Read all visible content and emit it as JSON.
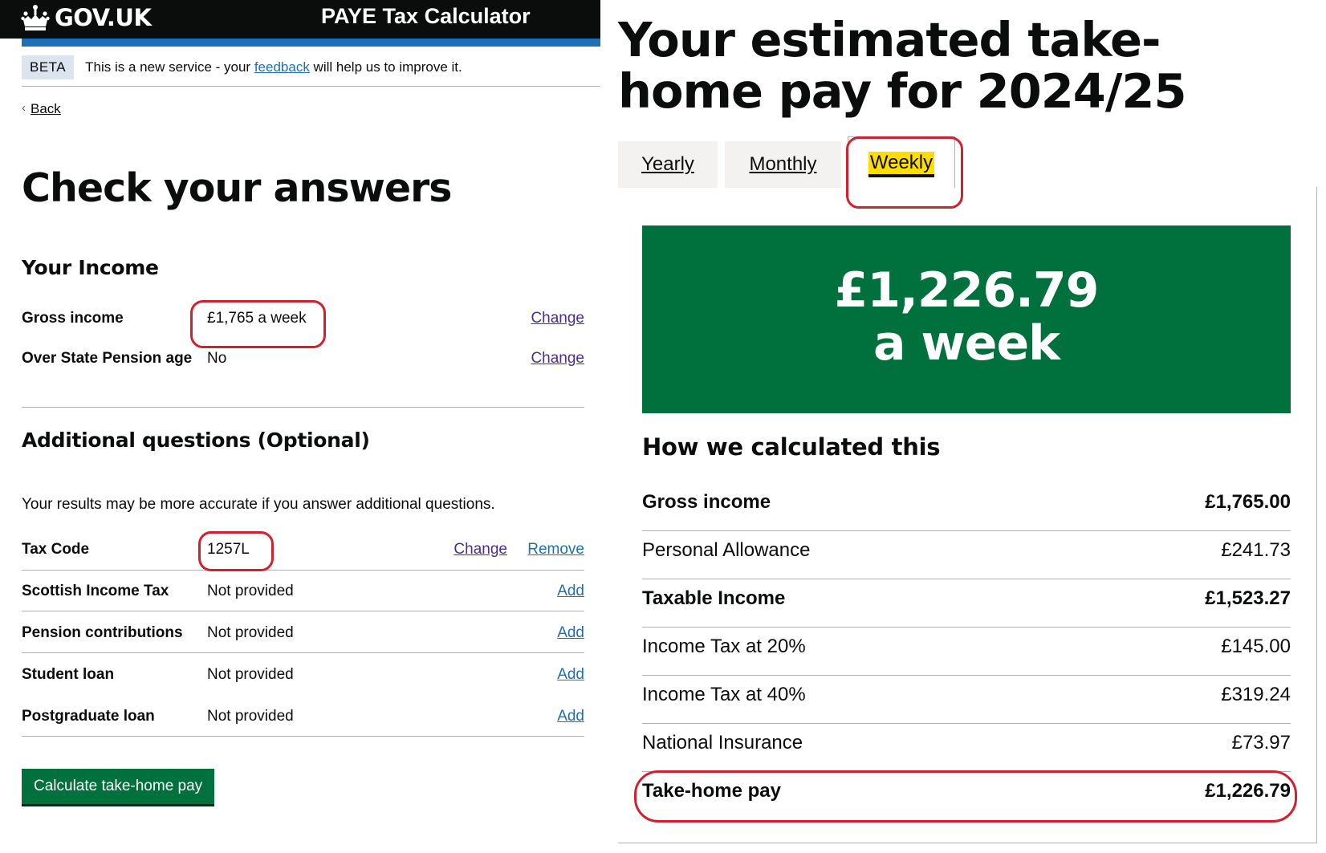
{
  "left": {
    "header": {
      "logo_text": "GOV.UK",
      "service_name": "PAYE Tax Calculator"
    },
    "beta": {
      "tag": "BETA",
      "text_before": "This is a new service - your ",
      "link": "feedback",
      "text_after": " will help us to improve it."
    },
    "back_label": "Back",
    "page_title": "Check your answers",
    "income": {
      "heading": "Your Income",
      "rows": [
        {
          "key": "Gross income",
          "value": "£1,765 a week",
          "action": "Change"
        },
        {
          "key": "Over State Pension age",
          "value": "No",
          "action": "Change"
        }
      ]
    },
    "additional": {
      "heading": "Additional questions (Optional)",
      "intro": "Your results may be more accurate if you answer additional questions.",
      "rows": [
        {
          "key": "Tax Code",
          "value": "1257L",
          "action": "Change",
          "action2": "Remove"
        },
        {
          "key": "Scottish Income Tax",
          "value": "Not provided",
          "action": "Add"
        },
        {
          "key": "Pension contributions",
          "value": "Not provided",
          "action": "Add"
        },
        {
          "key": "Student loan",
          "value": "Not provided",
          "action": "Add"
        },
        {
          "key": "Postgraduate loan",
          "value": "Not provided",
          "action": "Add"
        }
      ]
    },
    "calculate_button": "Calculate take-home pay"
  },
  "right": {
    "title": "Your estimated take-home pay for 2024/25",
    "tabs": [
      {
        "label": "Yearly",
        "selected": false
      },
      {
        "label": "Monthly",
        "selected": false
      },
      {
        "label": "Weekly",
        "selected": true
      }
    ],
    "result": {
      "amount": "£1,226.79",
      "period": "a week"
    },
    "breakdown_heading": "How we calculated this",
    "breakdown": [
      {
        "label": "Gross income",
        "value": "£1,765.00",
        "bold": true
      },
      {
        "label": "Personal Allowance",
        "value": "£241.73",
        "bold": false
      },
      {
        "label": "Taxable Income",
        "value": "£1,523.27",
        "bold": true
      },
      {
        "label": "Income Tax at 20%",
        "value": "£145.00",
        "bold": false
      },
      {
        "label": "Income Tax at 40%",
        "value": "£319.24",
        "bold": false
      },
      {
        "label": "National Insurance",
        "value": "£73.97",
        "bold": false
      },
      {
        "label": "Take-home pay",
        "value": "£1,226.79",
        "bold": true
      }
    ]
  },
  "colors": {
    "header_bg": "#0b0c0c",
    "brand_blue": "#1d70b8",
    "button_green": "#00703c",
    "focus_yellow": "#ffdd00",
    "highlight_red": "#d4202c"
  }
}
